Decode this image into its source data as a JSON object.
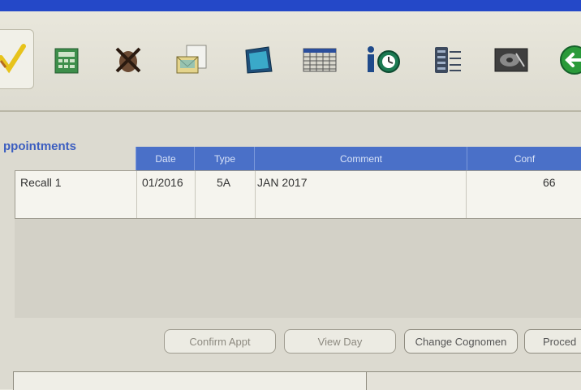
{
  "toolbar": {
    "icons": [
      "checkmark-icon",
      "spreadsheet-icon",
      "cancel-x-icon",
      "mail-envelope-icon",
      "screen-icon",
      "schedule-grid-icon",
      "info-clock-icon",
      "server-stack-icon",
      "disk-drive-icon",
      "back-arrow-icon"
    ]
  },
  "appointments": {
    "title": "ppointments",
    "columns": [
      "Date",
      "Type",
      "Comment",
      "Conf"
    ],
    "rows": [
      {
        "name": "Recall 1",
        "date": "01/2016",
        "type": "5A",
        "comment": "JAN 2017",
        "conf": "66"
      }
    ]
  },
  "buttons": {
    "confirm": "Confirm Appt",
    "view_day": "View Day",
    "change_cognomen": "Change Cognomen",
    "procedures": "Proced"
  },
  "colors": {
    "header_bar": "#4a70c8",
    "title_text": "#3c5ec0",
    "window_bar": "#2448c8"
  }
}
